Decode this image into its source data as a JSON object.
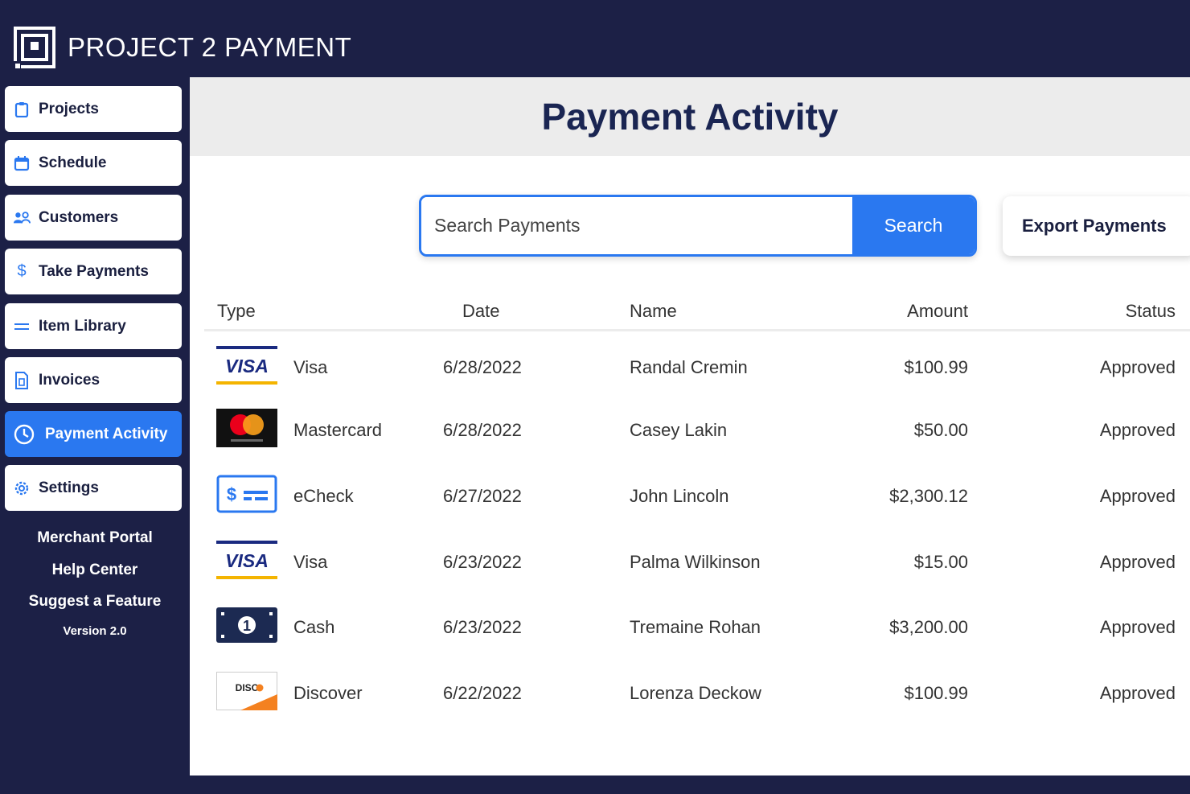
{
  "app": {
    "title": "PROJECT 2 PAYMENT"
  },
  "sidebar": {
    "items": [
      {
        "label": "Projects",
        "icon": "clipboard-icon"
      },
      {
        "label": "Schedule",
        "icon": "calendar-icon"
      },
      {
        "label": "Customers",
        "icon": "users-icon"
      },
      {
        "label": "Take Payments",
        "icon": "dollar-icon"
      },
      {
        "label": "Item Library",
        "icon": "list-icon"
      },
      {
        "label": "Invoices",
        "icon": "document-icon"
      },
      {
        "label": "Payment Activity",
        "icon": "clock-icon",
        "active": true
      },
      {
        "label": "Settings",
        "icon": "gear-icon"
      }
    ],
    "footer": {
      "merchant_portal": "Merchant Portal",
      "help_center": "Help Center",
      "suggest_feature": "Suggest a Feature",
      "version": "Version 2.0"
    }
  },
  "main": {
    "title": "Payment Activity",
    "search": {
      "placeholder": "Search Payments",
      "button_label": "Search"
    },
    "export_label": "Export Payments",
    "table": {
      "headers": {
        "type": "Type",
        "date": "Date",
        "name": "Name",
        "amount": "Amount",
        "status": "Status"
      },
      "rows": [
        {
          "type": "Visa",
          "icon": "visa-card-icon",
          "date": "6/28/2022",
          "name": "Randal Cremin",
          "amount": "$100.99",
          "status": "Approved"
        },
        {
          "type": "Mastercard",
          "icon": "mastercard-icon",
          "date": "6/28/2022",
          "name": "Casey Lakin",
          "amount": "$50.00",
          "status": "Approved"
        },
        {
          "type": "eCheck",
          "icon": "echeck-icon",
          "date": "6/27/2022",
          "name": "John Lincoln",
          "amount": "$2,300.12",
          "status": "Approved"
        },
        {
          "type": "Visa",
          "icon": "visa-card-icon",
          "date": "6/23/2022",
          "name": "Palma Wilkinson",
          "amount": "$15.00",
          "status": "Approved"
        },
        {
          "type": "Cash",
          "icon": "cash-icon",
          "date": "6/23/2022",
          "name": "Tremaine Rohan",
          "amount": "$3,200.00",
          "status": "Approved"
        },
        {
          "type": "Discover",
          "icon": "discover-card-icon",
          "date": "6/22/2022",
          "name": "Lorenza Deckow",
          "amount": "$100.99",
          "status": "Approved"
        }
      ]
    }
  },
  "colors": {
    "navy": "#1c2046",
    "accent": "#2a78f0",
    "title": "#1a2552"
  }
}
